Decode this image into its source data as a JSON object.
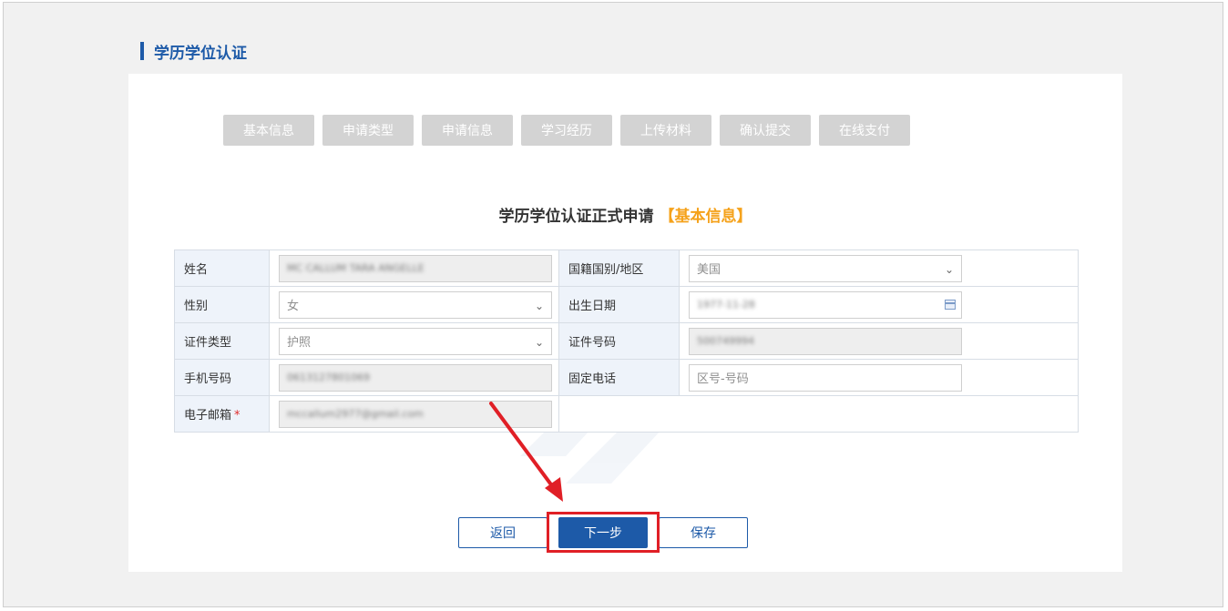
{
  "section": {
    "title": "学历学位认证"
  },
  "steps": [
    "基本信息",
    "申请类型",
    "申请信息",
    "学习经历",
    "上传材料",
    "确认提交",
    "在线支付"
  ],
  "form": {
    "title_main": "学历学位认证正式申请",
    "title_highlight": "【基本信息】",
    "labels": {
      "name": "姓名",
      "nationality": "国籍国别/地区",
      "gender": "性别",
      "birth_date": "出生日期",
      "id_type": "证件类型",
      "id_number": "证件号码",
      "mobile": "手机号码",
      "landline": "固定电话",
      "email": "电子邮箱",
      "required_mark": "*"
    },
    "values": {
      "name": "MC CALLUM TARA ANGELLE",
      "nationality": "美国",
      "gender": "女",
      "birth_date": "1977-11-28",
      "id_type": "护照",
      "id_number": "500749994",
      "mobile": "0613127801069",
      "email": "mccallum2977@gmail.com"
    },
    "placeholders": {
      "landline": "区号-号码"
    }
  },
  "buttons": {
    "back": "返回",
    "next": "下一步",
    "save": "保存"
  },
  "colors": {
    "brand": "#1d5aa8",
    "highlight": "#f5a21b",
    "annotation": "#e01f26",
    "step_inactive": "#d3d3d3"
  },
  "icons": {
    "dropdown": "chevron-down-icon",
    "calendar": "calendar-icon"
  }
}
